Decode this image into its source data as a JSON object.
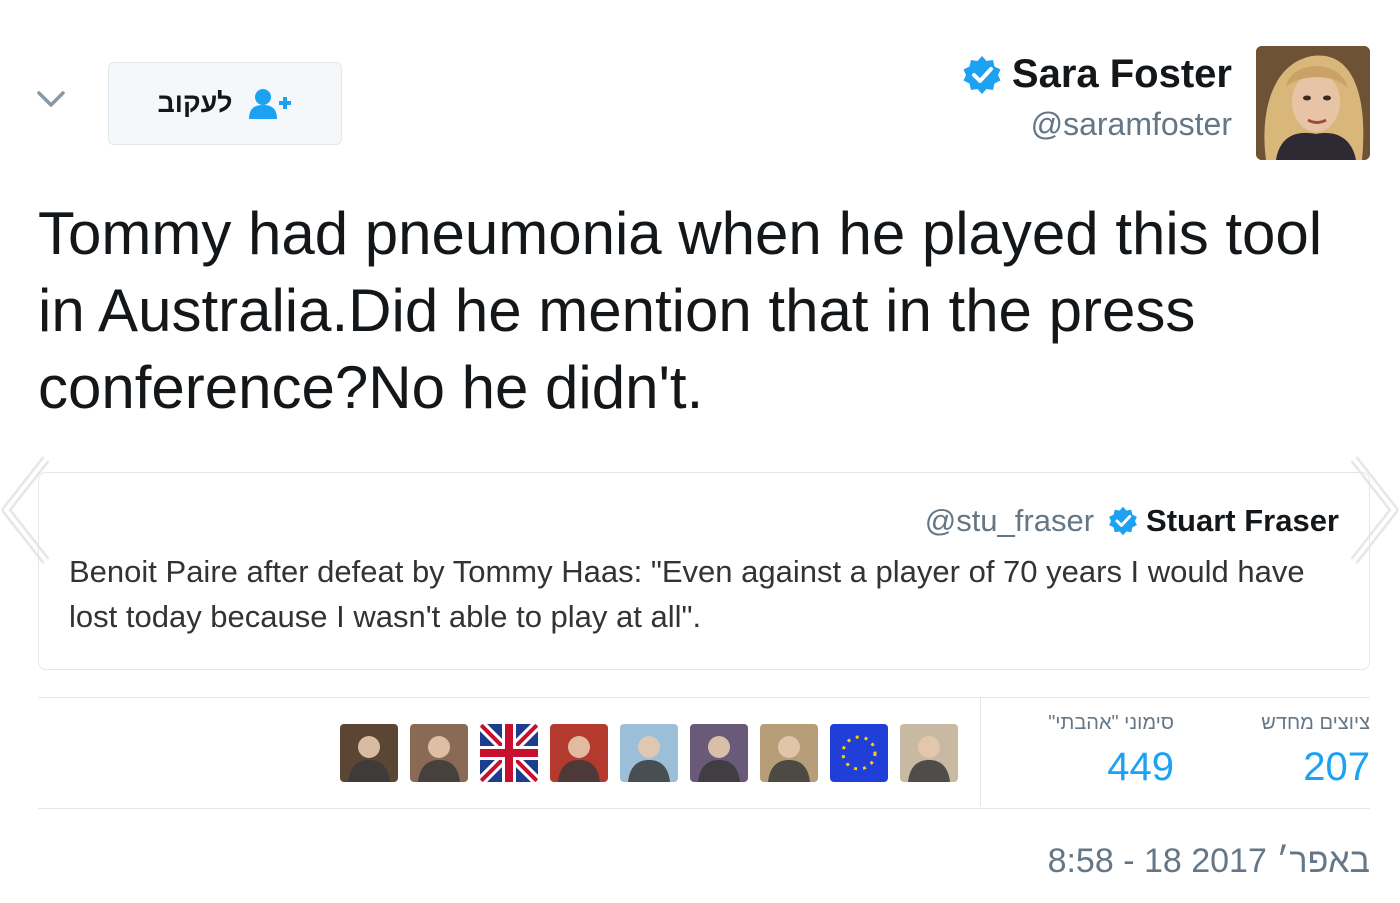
{
  "header": {
    "follow_label": "לעקוב",
    "display_name": "Sara Foster",
    "handle": "@saramfoster"
  },
  "tweet": {
    "text": "Tommy had pneumonia when he played this tool in Australia.Did he mention that in the press conference?No he didn't."
  },
  "quoted_tweet": {
    "display_name": "Stuart Fraser",
    "handle": "@stu_fraser",
    "text": "Benoit Paire after defeat by Tommy Haas: \"Even against a player of 70 years I would have lost today because I wasn't able to play at all\"."
  },
  "stats": {
    "retweets_label": "ציוצים מחדש",
    "retweets_value": "207",
    "likes_label": "סימוני \"אהבתי\"",
    "likes_value": "449"
  },
  "likers": [
    {
      "name": "liker-avatar-1",
      "color": "#5a4632"
    },
    {
      "name": "liker-avatar-2",
      "color": "#8a6a55"
    },
    {
      "name": "liker-avatar-3",
      "color": "#1d3d8f"
    },
    {
      "name": "liker-avatar-4",
      "color": "#b53a2e"
    },
    {
      "name": "liker-avatar-5",
      "color": "#9bbfd9"
    },
    {
      "name": "liker-avatar-6",
      "color": "#6a5a7a"
    },
    {
      "name": "liker-avatar-7",
      "color": "#b89e78"
    },
    {
      "name": "liker-avatar-8",
      "color": "#1f3fd8"
    },
    {
      "name": "liker-avatar-9",
      "color": "#c8b9a2"
    }
  ],
  "timestamp": "8:58 - 18 באפר׳ 2017",
  "colors": {
    "link_blue": "#1da1f2",
    "verified_blue": "#1da1f2",
    "muted_gray": "#657786",
    "border": "#e1e8ed"
  },
  "icons": {
    "menu": "chevron-down-icon",
    "follow": "add-user-icon",
    "verified": "verified-badge-icon",
    "previous": "chevron-left-icon",
    "next": "chevron-right-icon"
  }
}
